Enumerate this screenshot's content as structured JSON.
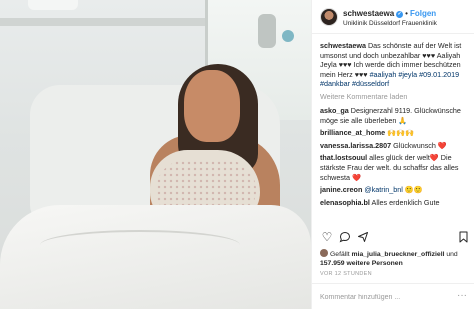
{
  "header": {
    "username": "schwestaewa",
    "separator": "•",
    "follow_label": "Folgen",
    "location": "Uniklinik Düsseldorf Frauenklinik"
  },
  "caption": {
    "username": "schwestaewa",
    "text": "Das schönste auf der Welt ist umsonst und doch unbezahlbar ♥♥♥ Aaliyah Jeyla ♥♥♥ Ich werde dich immer beschützen mein Herz ♥♥♥",
    "hashtags": "#aaliyah #jeyla #09.01.2019 #dankbar #düsseldorf"
  },
  "load_more": "Weitere Kommentare laden",
  "comments": [
    {
      "user": "asko_ga",
      "text": "Designerzahl 9119. Glückwünsche möge sie alle überleben 🙏"
    },
    {
      "user": "brilliance_at_home",
      "text": "🙌🙌🙌"
    },
    {
      "user": "vanessa.larissa.2807",
      "text": "Glückwunsch ❤️"
    },
    {
      "user": "that.lostsouul",
      "text": "alles glück der welt❤️ Die stärkste Frau der welt. du schaffsr das alles schwesta ❤️"
    },
    {
      "user": "janine.creon",
      "text": "@katrin_bnl 🙂🙂"
    },
    {
      "user": "elenasophia.bl",
      "text": "Alles erdenklich Gute"
    }
  ],
  "likes": {
    "prefix": "Gefällt",
    "user": "mia_julia_brueckner_offiziell",
    "middle": "und",
    "count": "157.959 weitere Personen"
  },
  "timestamp": "VOR 12 STUNDEN",
  "add_comment": {
    "placeholder": "Kommentar hinzufügen ...",
    "more": "···"
  },
  "icons": {
    "like": "heart-icon",
    "comment": "comment-icon",
    "share": "share-icon",
    "save": "bookmark-icon"
  },
  "colors": {
    "link": "#3897f0",
    "hashtag": "#003569",
    "muted": "#999999"
  }
}
